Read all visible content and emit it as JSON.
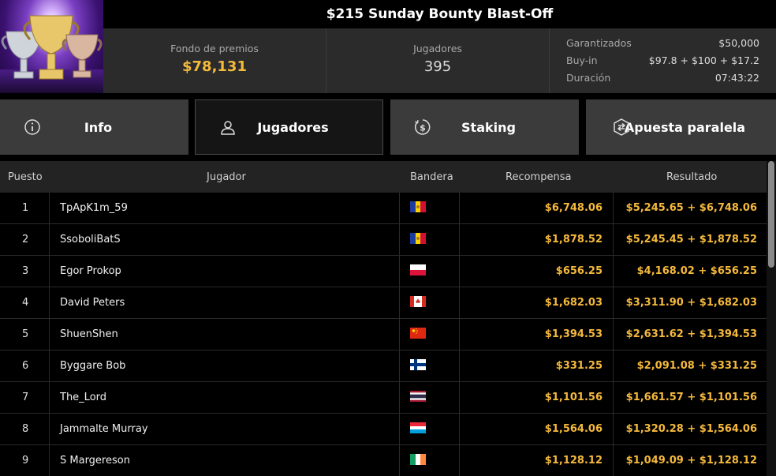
{
  "header": {
    "title": "$215 Sunday Bounty Blast-Off",
    "prize_pool": {
      "label": "Fondo de premios",
      "value": "$78,131"
    },
    "players": {
      "label": "Jugadores",
      "value": "395"
    },
    "details": [
      {
        "label": "Garantizados",
        "value": "$50,000"
      },
      {
        "label": "Buy-in",
        "value": "$97.8 + $100 + $17.2"
      },
      {
        "label": "Duración",
        "value": "07:43:22"
      }
    ]
  },
  "tabs": [
    {
      "label": "Info",
      "icon": "info-icon"
    },
    {
      "label": "Jugadores",
      "icon": "person-icon"
    },
    {
      "label": "Staking",
      "icon": "staking-coin-icon"
    },
    {
      "label": "Apuesta paralela",
      "icon": "side-bet-icon"
    }
  ],
  "active_tab": "Jugadores",
  "table": {
    "columns": [
      "Puesto",
      "Jugador",
      "Bandera",
      "Recompensa",
      "Resultado"
    ],
    "rows": [
      {
        "pos": "1",
        "name": "TpApK1m_59",
        "flag": "andorra-flag",
        "reward": "$6,748.06",
        "result": "$5,245.65 + $6,748.06"
      },
      {
        "pos": "2",
        "name": "SsoboliBatS",
        "flag": "andorra-flag",
        "reward": "$1,878.52",
        "result": "$5,245.45 + $1,878.52"
      },
      {
        "pos": "3",
        "name": "Egor Prokop",
        "flag": "poland-flag",
        "reward": "$656.25",
        "result": "$4,168.02 + $656.25"
      },
      {
        "pos": "4",
        "name": "David Peters",
        "flag": "canada-flag",
        "reward": "$1,682.03",
        "result": "$3,311.90 + $1,682.03"
      },
      {
        "pos": "5",
        "name": "ShuenShen",
        "flag": "china-flag",
        "reward": "$1,394.53",
        "result": "$2,631.62 + $1,394.53"
      },
      {
        "pos": "6",
        "name": "Byggare Bob",
        "flag": "finland-flag",
        "reward": "$331.25",
        "result": "$2,091.08 + $331.25"
      },
      {
        "pos": "7",
        "name": "The_Lord",
        "flag": "thailand-flag",
        "reward": "$1,101.56",
        "result": "$1,661.57 + $1,101.56"
      },
      {
        "pos": "8",
        "name": "Jammalte Murray",
        "flag": "luxembourg-flag",
        "reward": "$1,564.06",
        "result": "$1,320.28 + $1,564.06"
      },
      {
        "pos": "9",
        "name": "S Margereson",
        "flag": "ireland-flag",
        "reward": "$1,128.12",
        "result": "$1,049.09 + $1,128.12"
      }
    ]
  },
  "colors": {
    "accent": "#f5b93c",
    "panel": "#2b2b2b",
    "tab": "#3b3b3b"
  }
}
